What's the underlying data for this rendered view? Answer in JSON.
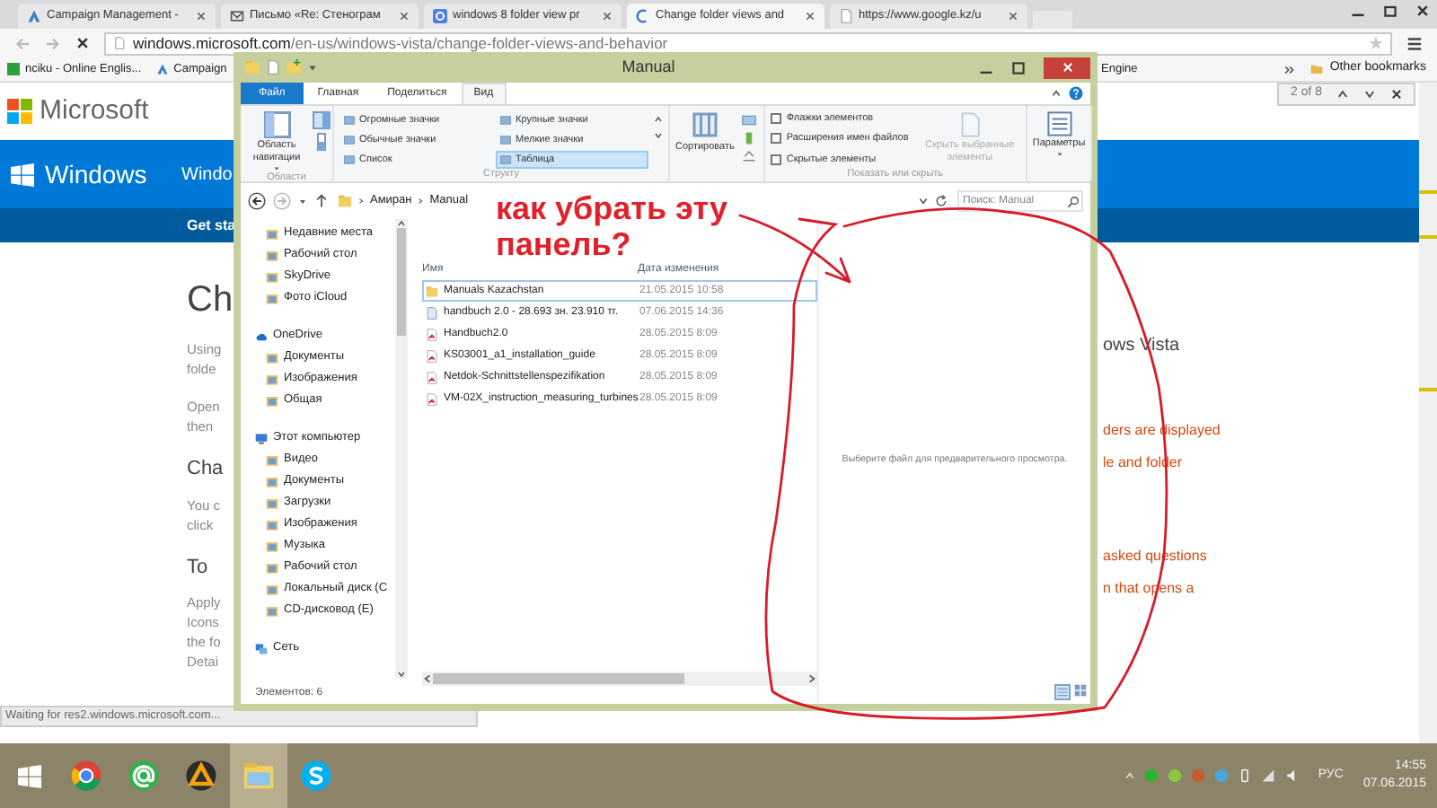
{
  "browser": {
    "tabs": [
      {
        "title": "Campaign Management -",
        "selected": false
      },
      {
        "title": "Письмо «Re: Стенограм",
        "selected": false
      },
      {
        "title": "windows 8 folder view pr",
        "selected": false
      },
      {
        "title": "Change folder views and",
        "selected": true
      },
      {
        "title": "https://www.google.kz/u",
        "selected": false
      }
    ],
    "address": {
      "host": "windows.microsoft.com",
      "path": "/en-us/windows-vista/change-folder-views-and-behavior"
    },
    "bookmarks": [
      {
        "label": "nciku - Online Englis..."
      },
      {
        "label": "Campaign"
      },
      {
        "label": "Engine"
      }
    ],
    "other_bookmarks": "Other bookmarks",
    "find_bar": {
      "count": "2 of 8"
    },
    "status": "Waiting for res2.windows.microsoft.com..."
  },
  "page": {
    "logo": "Microsoft",
    "band_title": "Windows",
    "band_nav": "Windo",
    "strip_link": "Get sta",
    "left_fragments": [
      {
        "kind": "title",
        "text": "Ch"
      },
      {
        "kind": "para",
        "text": "Using"
      },
      {
        "kind": "para",
        "text": "folde"
      },
      {
        "kind": "para",
        "text": "Open"
      },
      {
        "kind": "para",
        "text": "then"
      },
      {
        "kind": "heading",
        "text": "Cha"
      },
      {
        "kind": "para",
        "text": "You c"
      },
      {
        "kind": "para",
        "text": "click"
      },
      {
        "kind": "heading",
        "text": "To"
      },
      {
        "kind": "para",
        "text": "Apply"
      },
      {
        "kind": "para",
        "text": "Icons"
      },
      {
        "kind": "para",
        "text": "the fo"
      },
      {
        "kind": "para",
        "text": "Detai"
      }
    ],
    "right_title": "ows Vista",
    "right_links": [
      "ders are displayed",
      "le and folder",
      "asked questions",
      "n that opens a"
    ]
  },
  "explorer": {
    "title": "Manual",
    "ribbon_tabs": [
      {
        "label": "Файл",
        "selected": false,
        "kind": "file"
      },
      {
        "label": "Главная",
        "selected": false,
        "kind": "tab"
      },
      {
        "label": "Поделиться",
        "selected": false,
        "kind": "tab"
      },
      {
        "label": "Вид",
        "selected": true,
        "kind": "tab"
      }
    ],
    "nav_pane_button": "Область навигации",
    "group_areas": "Области",
    "layouts": [
      {
        "label": "Огромные значки",
        "selected": false
      },
      {
        "label": "Крупные значки",
        "selected": false
      },
      {
        "label": "Обычные значки",
        "selected": false
      },
      {
        "label": "Мелкие значки",
        "selected": false
      },
      {
        "label": "Список",
        "selected": false
      },
      {
        "label": "Таблица",
        "selected": true
      }
    ],
    "group_layout": "Структу",
    "sort_button": "Сортировать",
    "show_hide": [
      {
        "label": "Флажки элементов",
        "checked": false
      },
      {
        "label": "Расширения имен файлов",
        "checked": false
      },
      {
        "label": "Скрытые элементы",
        "checked": false
      }
    ],
    "hide_selected": "Скрыть выбранные элементы",
    "options_button": "Параметры",
    "group_show_hide": "Показать или скрыть",
    "breadcrumb": [
      "Амиран",
      "Manual"
    ],
    "search": {
      "placeholder": "Поиск: Manual"
    },
    "favorites": [
      "Недавние места",
      "Рабочий стол",
      "SkyDrive",
      "Фото iCloud"
    ],
    "nav_tree": [
      {
        "label": "OneDrive",
        "children": [
          "Документы",
          "Изображения",
          "Общая"
        ]
      },
      {
        "label": "Этот компьютер",
        "children": [
          "Видео",
          "Документы",
          "Загрузки",
          "Изображения",
          "Музыка",
          "Рабочий стол",
          "Локальный диск (C",
          "CD-дисковод (E)"
        ]
      },
      {
        "label": "Сеть"
      }
    ],
    "columns": [
      "Имя",
      "Дата изменения"
    ],
    "files": [
      {
        "name": "Manuals Kazachstan",
        "date": "21.05.2015 10:58",
        "kind": "folder",
        "selected": true
      },
      {
        "name": "handbuch 2.0 - 28.693 зн. 23.910 тг.",
        "date": "07.06.2015 14:36",
        "kind": "doc",
        "selected": false
      },
      {
        "name": "Handbuch2.0",
        "date": "28.05.2015 8:09",
        "kind": "pdf",
        "selected": false
      },
      {
        "name": "KS03001_a1_installation_guide",
        "date": "28.05.2015 8:09",
        "kind": "pdf",
        "selected": false
      },
      {
        "name": "Netdok-Schnittstellenspezifikation",
        "date": "28.05.2015 8:09",
        "kind": "pdf",
        "selected": false
      },
      {
        "name": "VM-02X_instruction_measuring_turbines",
        "date": "28.05.2015 8:09",
        "kind": "pdf",
        "selected": false
      }
    ],
    "preview_hint": "Выберите файл для предварительного просмотра.",
    "status": "Элементов: 6"
  },
  "annotation": {
    "text": "как убрать эту панель?"
  },
  "taskbar": {
    "language": "РУС",
    "time": "14:55",
    "date": "07.06.2015"
  }
}
